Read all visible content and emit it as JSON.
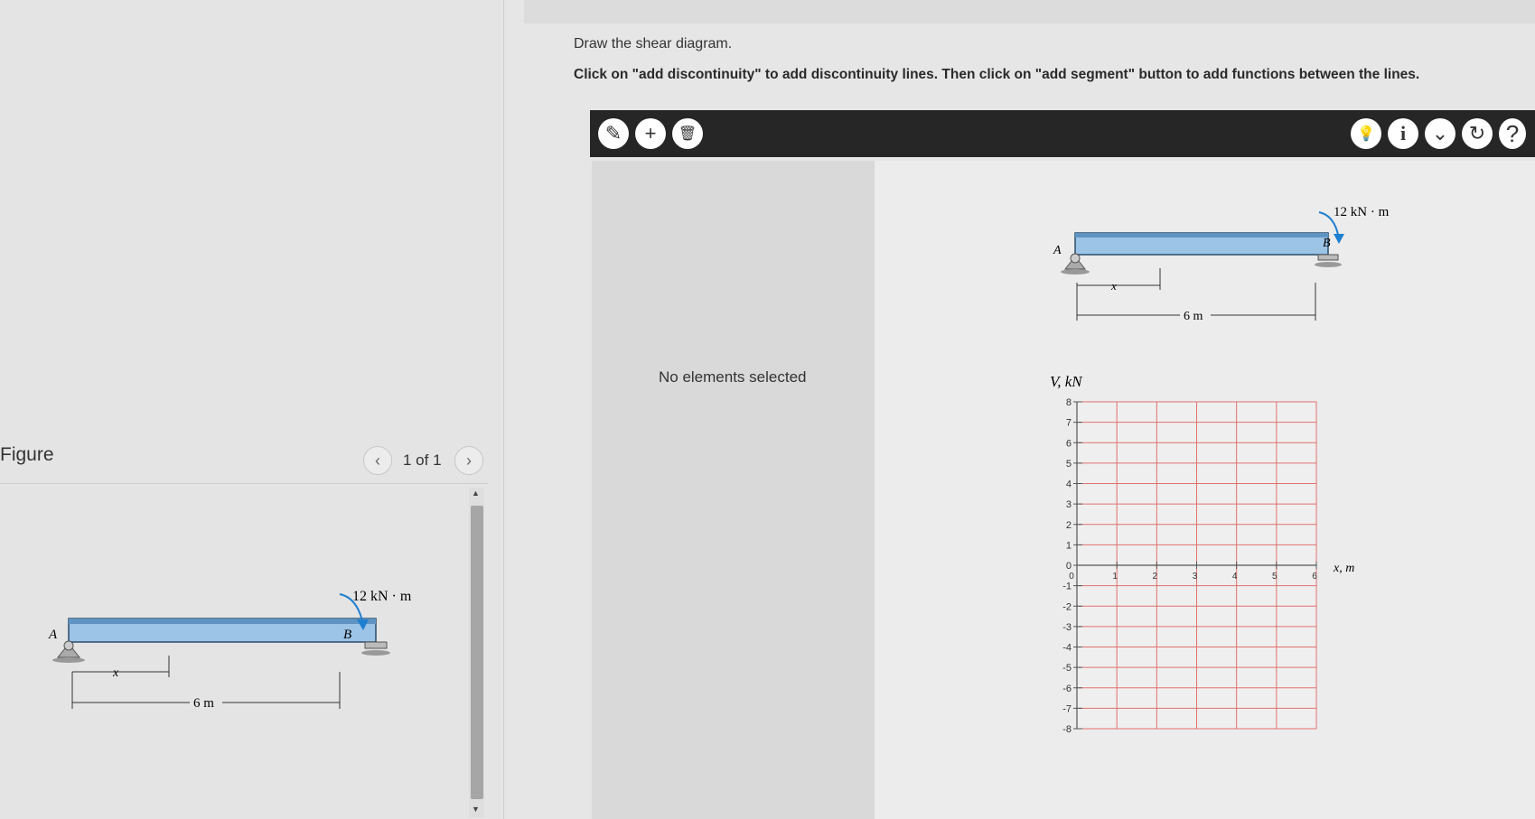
{
  "figure_panel": {
    "title": "Figure",
    "pager": "1 of 1",
    "prev_icon": "‹",
    "next_icon": "›",
    "scroll_up_icon": "▲",
    "scroll_down_icon": "▼"
  },
  "beam_figure": {
    "moment_label": "12 kN · m",
    "support_a": "A",
    "support_b": "B",
    "x_label": "x",
    "span_label": "6 m",
    "moment_color": "#1f7fd0",
    "beam_color": "#9cc4e6"
  },
  "instructions": {
    "line1": "Draw the shear diagram.",
    "line2": "Click on \"add discontinuity\" to add discontinuity lines. Then click on \"add segment\" button to add functions between the lines."
  },
  "toolbar": {
    "tools": [
      {
        "name": "add-discontinuity",
        "icon": "pencil-plus-icon",
        "glyph": "✎"
      },
      {
        "name": "add-segment",
        "icon": "plus-icon",
        "glyph": "+"
      },
      {
        "name": "delete",
        "icon": "trash-icon",
        "glyph": "🗑"
      }
    ],
    "actions": [
      {
        "name": "hint",
        "icon": "lightbulb-icon",
        "glyph": "💡"
      },
      {
        "name": "info",
        "icon": "info-icon",
        "glyph": "i"
      },
      {
        "name": "expand",
        "icon": "chevron-down-icon",
        "glyph": "⌄"
      },
      {
        "name": "reset",
        "icon": "reset-icon",
        "glyph": "↻"
      },
      {
        "name": "help",
        "icon": "help-icon",
        "glyph": "?"
      }
    ]
  },
  "properties_panel": {
    "empty_text": "No elements selected"
  },
  "chart_data": {
    "type": "line",
    "ylabel": "V, kN",
    "xlabel": "x, m",
    "xlim": [
      0,
      6
    ],
    "ylim": [
      -8,
      8
    ],
    "x_ticks": [
      0,
      1,
      2,
      3,
      4,
      5,
      6
    ],
    "y_ticks": [
      8,
      7,
      6,
      5,
      4,
      3,
      2,
      1,
      0,
      -1,
      -2,
      -3,
      -4,
      -5,
      -6,
      -7,
      -8
    ],
    "grid": true,
    "grid_color": "#e07070",
    "series": []
  }
}
